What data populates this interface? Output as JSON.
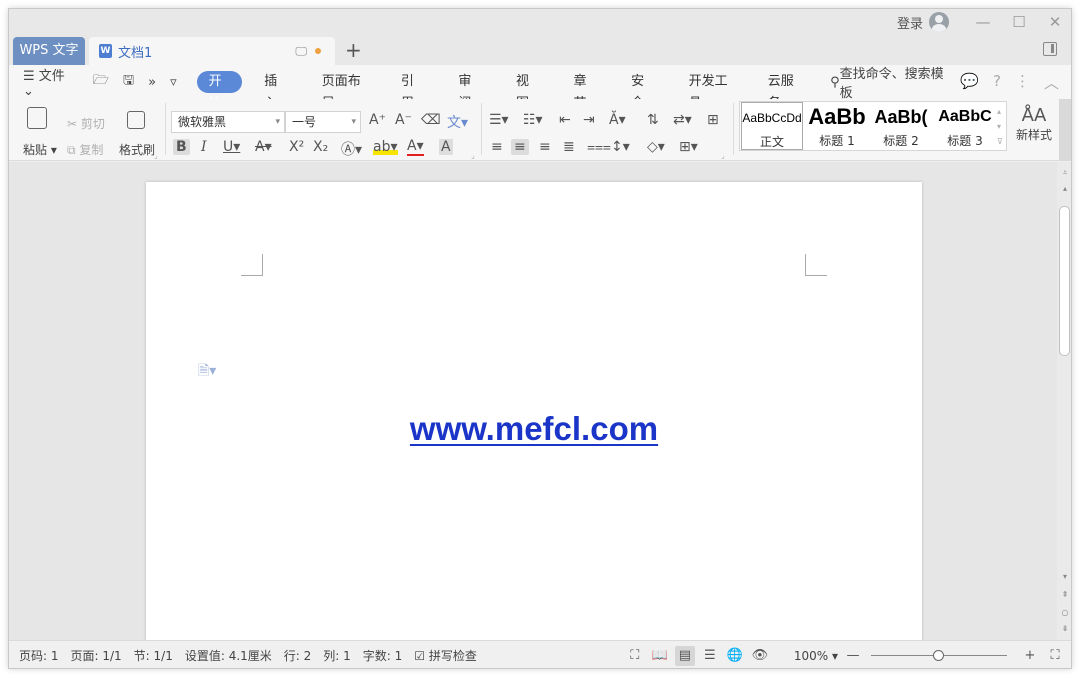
{
  "window": {
    "login_label": "登录",
    "tabs": {
      "app": "WPS 文字",
      "document": "文档1"
    }
  },
  "menubar": {
    "file_label": "文件",
    "tabs": [
      "开始",
      "插入",
      "页面布局",
      "引用",
      "审阅",
      "视图",
      "章节",
      "安全",
      "开发工具",
      "云服务"
    ],
    "active_tab": "开始",
    "search_label": "查找命令、搜索模板"
  },
  "ribbon": {
    "paste": "粘贴",
    "cut": "剪切",
    "copy": "复制",
    "format_painter": "格式刷",
    "font_name": "微软雅黑",
    "font_size": "一号",
    "styles": [
      {
        "preview": "AaBbCcDd",
        "label": "正文"
      },
      {
        "preview": "AaBb",
        "label": "标题 1"
      },
      {
        "preview": "AaBb(",
        "label": "标题 2"
      },
      {
        "preview": "AaBbC",
        "label": "标题 3"
      }
    ],
    "new_style": "新样式"
  },
  "document": {
    "content": "www.mefcl.com"
  },
  "statusbar": {
    "page_code": "页码: 1",
    "pages": "页面: 1/1",
    "section": "节: 1/1",
    "position": "设置值: 4.1厘米",
    "row": "行: 2",
    "col": "列: 1",
    "word_count": "字数: 1",
    "spell_check": "拼写检查",
    "zoom": "100%"
  },
  "colors": {
    "accent": "#5b89d8",
    "tab_active": "#6e8fc1",
    "link": "#1a35c8"
  }
}
